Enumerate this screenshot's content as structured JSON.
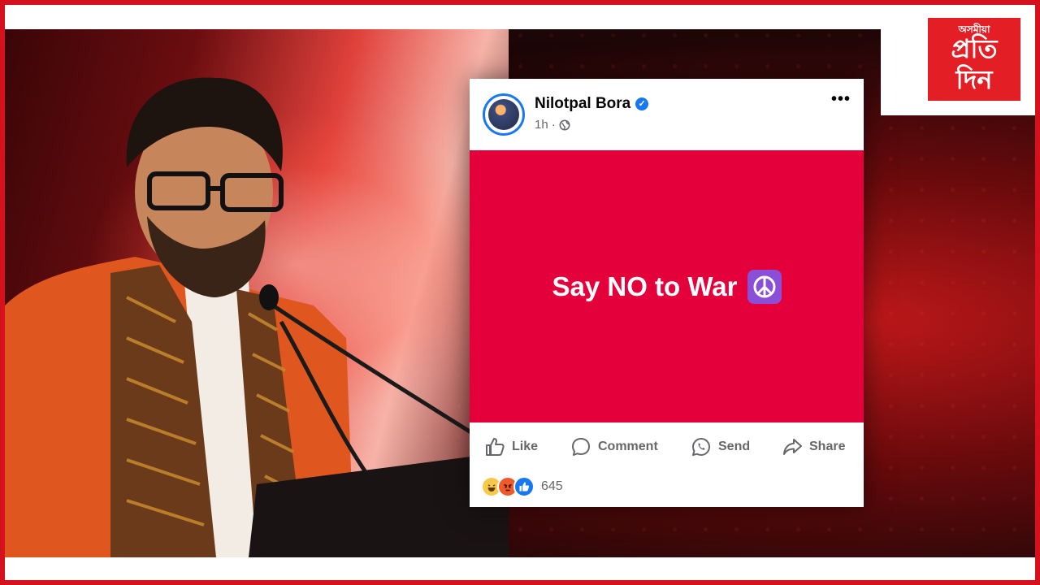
{
  "brand": {
    "logo_small_text": "অসমীয়া",
    "logo_line1": "প্ৰতি",
    "logo_line2": "দিন"
  },
  "post": {
    "author_name": "Nilotpal Bora",
    "verified": true,
    "timestamp": "1h",
    "separator": "·",
    "audience_icon": "globe-icon",
    "more_label": "•••",
    "body_text": "Say NO to War",
    "body_emoji": "peace-symbol",
    "body_background": "#e4003a",
    "actions": [
      {
        "label": "Like",
        "icon": "thumbs-up-icon"
      },
      {
        "label": "Comment",
        "icon": "comment-icon"
      },
      {
        "label": "Send",
        "icon": "whatsapp-icon"
      },
      {
        "label": "Share",
        "icon": "share-icon"
      }
    ],
    "reactions": [
      "haha",
      "angry",
      "like"
    ],
    "reaction_count": "645"
  },
  "colors": {
    "frame_red": "#d4111c",
    "facebook_blue": "#1877f2",
    "logo_red": "#e31e24"
  }
}
